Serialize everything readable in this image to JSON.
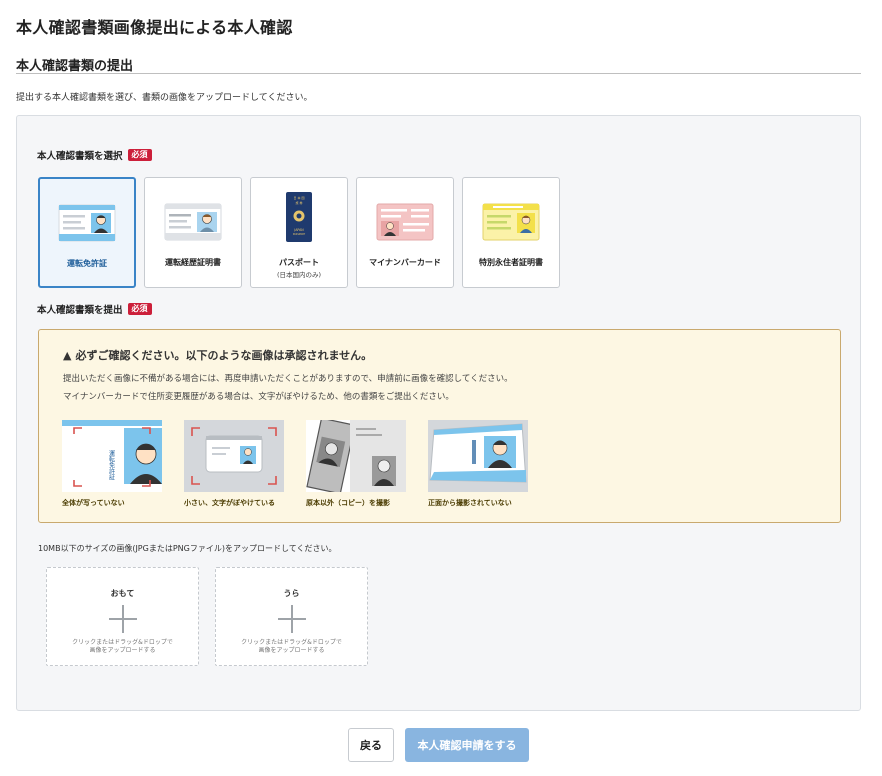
{
  "page": {
    "title": "本人確認書類画像提出による本人確認",
    "section_title": "本人確認書類の提出",
    "intro": "提出する本人確認書類を選び、書類の画像をアップロードしてください。"
  },
  "select_section": {
    "label": "本人確認書類を選択",
    "required_badge": "必須",
    "selected_index": 0,
    "cards": [
      {
        "label": "運転免許証",
        "sublabel": "",
        "icon": "drivers-license-icon"
      },
      {
        "label": "運転経歴証明書",
        "sublabel": "",
        "icon": "driving-history-certificate-icon"
      },
      {
        "label": "パスポート",
        "sublabel": "(日本国内のみ)",
        "icon": "passport-icon"
      },
      {
        "label": "マイナンバーカード",
        "sublabel": "",
        "icon": "my-number-card-icon"
      },
      {
        "label": "特別永住者証明書",
        "sublabel": "",
        "icon": "special-permanent-resident-certificate-icon"
      }
    ]
  },
  "submit_section": {
    "label": "本人確認書類を提出",
    "required_badge": "必須"
  },
  "warning": {
    "title": "必ずご確認ください。以下のような画像は承認されません。",
    "lines": [
      "提出いただく画像に不備がある場合には、再度申請いただくことがありますので、申請前に画像を確認してください。",
      "マイナンバーカードで住所変更履歴がある場合は、文字がぼやけるため、他の書類をご提出ください。"
    ],
    "examples": [
      {
        "caption": "全体が写っていない"
      },
      {
        "caption": "小さい、文字がぼやけている"
      },
      {
        "caption": "原本以外（コピー）を撮影"
      },
      {
        "caption": "正面から撮影されていない"
      }
    ],
    "example_card_text": "運転免許証"
  },
  "upload": {
    "note": "10MB以下のサイズの画像(JPGまたはPNGファイル)をアップロードしてください。",
    "boxes": [
      {
        "side": "おもて",
        "hint_line1": "クリックまたはドラッグ&ドロップで",
        "hint_line2": "画像をアップロードする"
      },
      {
        "side": "うら",
        "hint_line1": "クリックまたはドラッグ&ドロップで",
        "hint_line2": "画像をアップロードする"
      }
    ]
  },
  "passport_text": {
    "top": "日 本 国",
    "mid": "旅 券",
    "name": "JAPAN",
    "sub": "PASSPORT"
  },
  "actions": {
    "back_label": "戻る",
    "submit_label": "本人確認申請をする"
  },
  "colors": {
    "accent": "#3a84c7",
    "required": "#cc1f3a",
    "warning_bg": "#fdf7e3",
    "warning_border": "#c9a96e",
    "submit_disabled": "#89b5e0",
    "license_blue": "#7cc4ec",
    "mynumber_pink": "#f4c4c4",
    "resident_yellow": "#f3e04a"
  }
}
